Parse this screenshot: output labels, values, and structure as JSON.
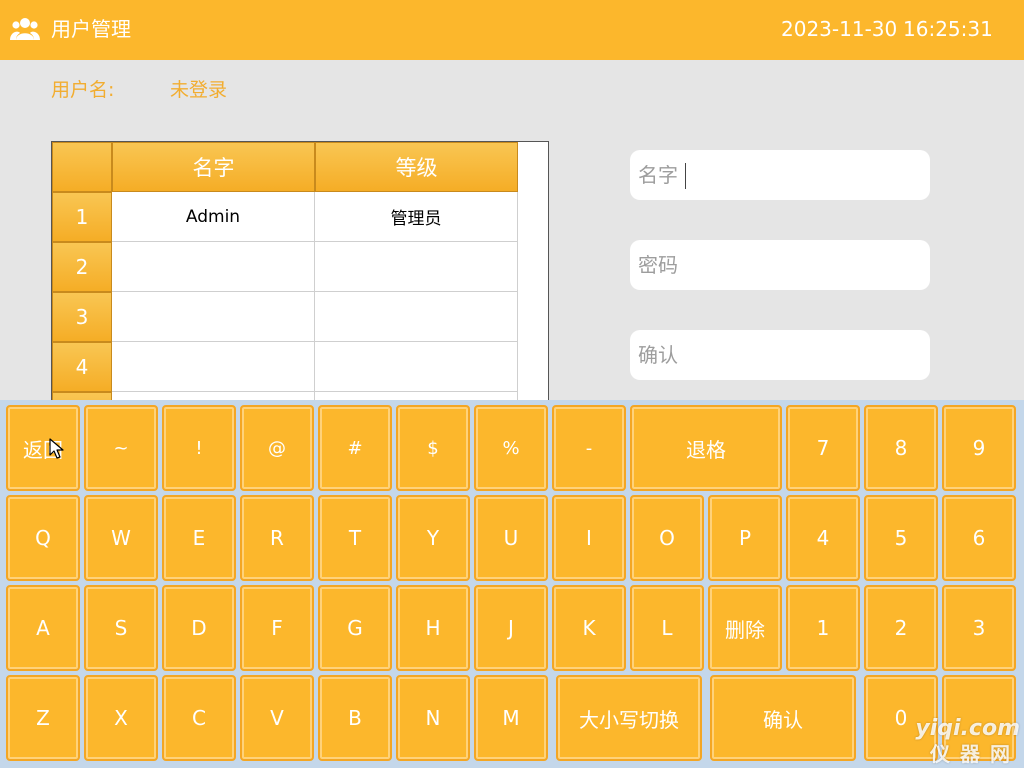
{
  "header": {
    "title": "用户管理",
    "date": "2023-11-30",
    "time": "16:25:31",
    "icon": "users-icon",
    "color": "#fcb72c"
  },
  "user": {
    "label": "用户名:",
    "value": "未登录"
  },
  "table": {
    "columns": [
      "名字",
      "等级"
    ],
    "rows": [
      {
        "num": "1",
        "name": "Admin",
        "level": "管理员"
      },
      {
        "num": "2",
        "name": "",
        "level": ""
      },
      {
        "num": "3",
        "name": "",
        "level": ""
      },
      {
        "num": "4",
        "name": "",
        "level": ""
      },
      {
        "num": "",
        "name": "",
        "level": ""
      }
    ]
  },
  "form": {
    "name_placeholder": "名字",
    "password_placeholder": "密码",
    "confirm_placeholder": "确认"
  },
  "keyboard": {
    "row1": [
      "返回",
      "~",
      "!",
      "@",
      "#",
      "$",
      "%",
      "-",
      "退格",
      "7",
      "8",
      "9"
    ],
    "row2": [
      "Q",
      "W",
      "E",
      "R",
      "T",
      "Y",
      "U",
      "I",
      "O",
      "P",
      "4",
      "5",
      "6"
    ],
    "row3": [
      "A",
      "S",
      "D",
      "F",
      "G",
      "H",
      "J",
      "K",
      "L",
      "删除",
      "1",
      "2",
      "3"
    ],
    "row4": [
      "Z",
      "X",
      "C",
      "V",
      "B",
      "N",
      "M",
      "大小写切换",
      "确认",
      "0",
      ""
    ]
  },
  "watermark": {
    "domain": "yiqi.com",
    "chinese": "仪器网"
  }
}
